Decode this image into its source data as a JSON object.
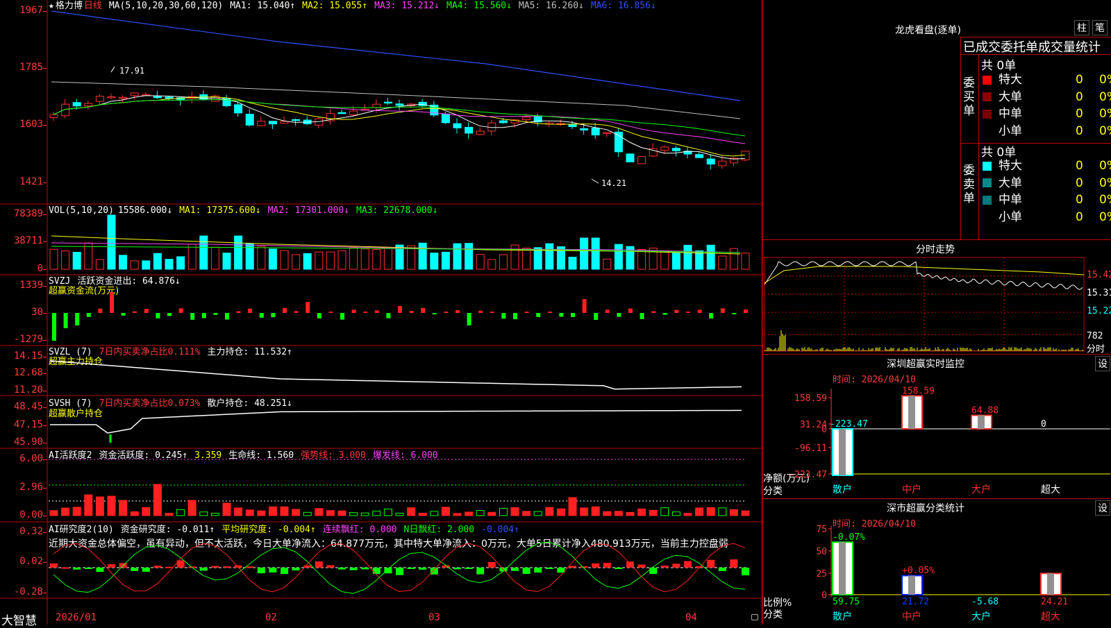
{
  "header": {
    "star": "★",
    "stock_name": "格力博",
    "period": "日线",
    "ma_label": "MA(5,10,20,30,60,120)",
    "ma_values": [
      {
        "label": "MA1: 15.040↑",
        "color": "#ffffff"
      },
      {
        "label": "MA2: 15.055↑",
        "color": "#ffff00"
      },
      {
        "label": "MA3: 15.212↓",
        "color": "#ff44ff"
      },
      {
        "label": "MA4: 15.560↓",
        "color": "#00ff00"
      },
      {
        "label": "MA5: 16.260↓",
        "color": "#c0c0c0"
      },
      {
        "label": "MA6: 16.856↓",
        "color": "#3050ff"
      }
    ]
  },
  "price_axis": [
    "1967",
    "1785",
    "1603",
    "1421"
  ],
  "price_annotations": {
    "high": "17.91",
    "low": "14.21"
  },
  "vol": {
    "label": "VOL(5,10,20)",
    "items": [
      {
        "label": "15586.000↓",
        "color": "#ffffff"
      },
      {
        "label": "MA1: 17375.600↓",
        "color": "#ffff00"
      },
      {
        "label": "MA2: 17301.000↓",
        "color": "#ff44ff"
      },
      {
        "label": "MA3: 22678.000↓",
        "color": "#00ff00"
      }
    ],
    "axis": [
      "78389",
      "38711",
      "0"
    ]
  },
  "svzj": {
    "label": "SVZJ",
    "items": [
      {
        "label": "活跃资金进出: 64.876↓",
        "color": "#ffffff"
      }
    ],
    "sub": "超赢资金流(万元)",
    "axis": [
      "1339",
      "30",
      "-1279"
    ]
  },
  "svzl": {
    "label": "SVZL (7)",
    "items": [
      {
        "label": "7日内买卖净占比0.111%",
        "color": "#ff3c3c"
      },
      {
        "label": "主力持仓: 11.532↑",
        "color": "#ffffff"
      }
    ],
    "sub": "超赢主力持仓",
    "axis": [
      "14.15",
      "12.68",
      "11.20"
    ]
  },
  "svsh": {
    "label": "SVSH (7)",
    "items": [
      {
        "label": "7日内买卖净占比0.073%",
        "color": "#ff3c3c"
      },
      {
        "label": "散户持仓: 48.251↓",
        "color": "#ffffff"
      }
    ],
    "sub": "超赢散户持仓",
    "axis": [
      "48.45",
      "47.15",
      "45.90"
    ]
  },
  "ai_active": {
    "label": "AI活跃度2",
    "items": [
      {
        "label": "资金活跃度: 0.245↑",
        "color": "#ffffff"
      },
      {
        "label": "3.359",
        "color": "#ffff00"
      },
      {
        "label": "生命线: 1.560",
        "color": "#ffffff"
      },
      {
        "label": "强势线: 3.000",
        "color": "#ff3c3c"
      },
      {
        "label": "爆发线: 6.000",
        "color": "#ff44ff"
      }
    ],
    "axis": [
      "6.00",
      "2.96",
      "0.00"
    ]
  },
  "ai_research": {
    "label": "AI研究度2(10)",
    "items": [
      {
        "label": "资金研究度: -0.011↑",
        "color": "#ffffff"
      },
      {
        "label": "平均研究度: -0.004↑",
        "color": "#ffff00"
      },
      {
        "label": "连续飘红: 0.000",
        "color": "#ff44ff"
      },
      {
        "label": "N日飘红: 2.000",
        "color": "#00ff00"
      },
      {
        "label": "-0.004↑",
        "color": "#3050ff"
      }
    ],
    "comment": "近期大资金总体偏空，虽有异动，但不太活跃，今日大单净流入：64.877万元，其中特大单净流入：0万元，大单5日累计净入480.913万元，当前主力控盘弱",
    "axis": [
      "0.32",
      "0.02",
      "-0.28"
    ]
  },
  "date_axis": {
    "corner": "大智慧",
    "labels": [
      "2026/01",
      "02",
      "03",
      "04"
    ]
  },
  "dragon": {
    "title": "龙虎看盘(逐单)",
    "btn1": "柱",
    "btn2": "笔",
    "stats_title": "已成交委托单成交量统计",
    "buy_label": "委买单",
    "sell_label": "委卖单",
    "buy_total": "共 0单",
    "sell_total": "共 0单",
    "buy_rows": [
      {
        "name": "特大",
        "val": "0",
        "pct": "0%",
        "color": "#ff0000"
      },
      {
        "name": "大单",
        "val": "0",
        "pct": "0%",
        "color": "#8b0000"
      },
      {
        "name": "中单",
        "val": "0",
        "pct": "0%",
        "color": "#7a0000"
      },
      {
        "name": "小单",
        "val": "0",
        "pct": "0%",
        "color": ""
      }
    ],
    "sell_rows": [
      {
        "name": "特大",
        "val": "0",
        "pct": "0%",
        "color": "#00ffff"
      },
      {
        "name": "大单",
        "val": "0",
        "pct": "0%",
        "color": "#008b8b"
      },
      {
        "name": "中单",
        "val": "0",
        "pct": "0%",
        "color": "#007a7a"
      },
      {
        "name": "小单",
        "val": "0",
        "pct": "0%",
        "color": ""
      }
    ]
  },
  "intraday": {
    "title": "分时走势",
    "axis_right": [
      "15.42",
      "15.31",
      "15.22",
      "782",
      "分时"
    ]
  },
  "monitor": {
    "title": "深圳超赢实时监控",
    "set_btn": "设",
    "time": "时间: 2026/04/10",
    "axis": [
      "158.59",
      "31.24",
      "0",
      "-96.11",
      "-223.47"
    ],
    "unit_label": "净额(万元)",
    "cat_label": "分类",
    "categories": [
      "散户",
      "中户",
      "大户",
      "超大"
    ],
    "values": [
      -223.47,
      158.59,
      64.88,
      0
    ],
    "value_labels": [
      "-223.47",
      "158.59",
      "64.88",
      "0"
    ]
  },
  "classify": {
    "title": "深市超赢分类统计",
    "set_btn": "设",
    "time": "时间: 2026/04/10",
    "axis": [
      "75",
      "50",
      "25",
      "0"
    ],
    "ratio_label": "比例%",
    "cat_label": "分类",
    "categories": [
      "散户",
      "中户",
      "大户",
      "超大"
    ],
    "top_labels": [
      "-0.07%",
      "+0.05%",
      "",
      ""
    ],
    "bottom_labels": [
      "59.75",
      "21.72",
      "-5.68",
      "24.21"
    ],
    "values": [
      59.75,
      21.72,
      -5.68,
      24.21
    ]
  }
}
